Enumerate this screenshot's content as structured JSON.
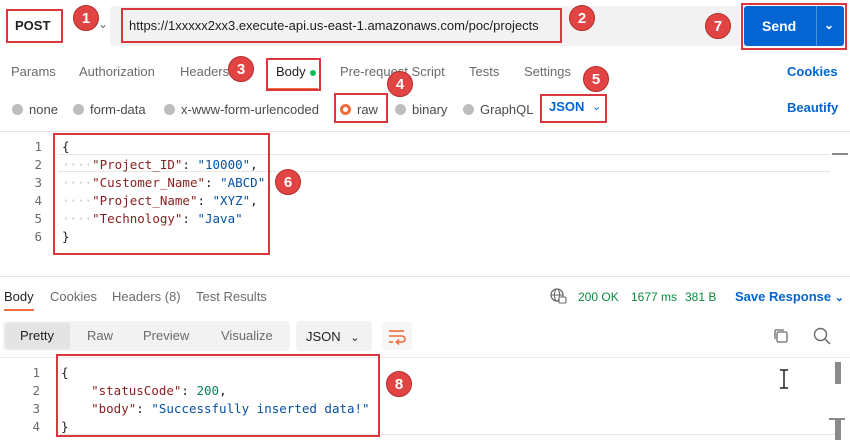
{
  "request": {
    "method": "POST",
    "url": "https://1xxxxx2xx3.execute-api.us-east-1.amazonaws.com/poc/projects",
    "send_label": "Send"
  },
  "tabs": [
    {
      "label": "Params"
    },
    {
      "label": "Authorization"
    },
    {
      "label": "Headers"
    },
    {
      "label": "Body"
    },
    {
      "label": "Pre-request Script"
    },
    {
      "label": "Tests"
    },
    {
      "label": "Settings"
    }
  ],
  "cookies_label": "Cookies",
  "body_types": [
    {
      "label": "none"
    },
    {
      "label": "form-data"
    },
    {
      "label": "x-www-form-urlencoded"
    },
    {
      "label": "raw"
    },
    {
      "label": "binary"
    },
    {
      "label": "GraphQL"
    }
  ],
  "body_format": "JSON",
  "beautify_label": "Beautify",
  "request_body_lines": [
    {
      "no": "1",
      "open": "{"
    },
    {
      "no": "2",
      "key": "\"Project_ID\"",
      "value": "\"10000\"",
      "comma": ","
    },
    {
      "no": "3",
      "key": "\"Customer_Name\"",
      "value": "\"ABCD\"",
      "comma": ","
    },
    {
      "no": "4",
      "key": "\"Project_Name\"",
      "value": "\"XYZ\"",
      "comma": ","
    },
    {
      "no": "5",
      "key": "\"Technology\"",
      "value": "\"Java\"",
      "comma": ""
    },
    {
      "no": "6",
      "close": "}"
    }
  ],
  "response": {
    "tabs": [
      {
        "label": "Body"
      },
      {
        "label": "Cookies"
      },
      {
        "label": "Headers (8)"
      },
      {
        "label": "Test Results"
      }
    ],
    "status": "200 OK",
    "time": "1677 ms",
    "size": "381 B",
    "save_label": "Save Response",
    "views": [
      {
        "label": "Pretty"
      },
      {
        "label": "Raw"
      },
      {
        "label": "Preview"
      },
      {
        "label": "Visualize"
      }
    ],
    "format": "JSON",
    "body_lines": [
      {
        "no": "1",
        "open": "{"
      },
      {
        "no": "2",
        "key": "\"statusCode\"",
        "value": "200",
        "comma": ","
      },
      {
        "no": "3",
        "key": "\"body\"",
        "value": "\"Successfully inserted data!\"",
        "comma": ""
      },
      {
        "no": "4",
        "close": "}"
      }
    ]
  },
  "annotations": [
    "1",
    "2",
    "3",
    "4",
    "5",
    "6",
    "7",
    "8"
  ],
  "colors": {
    "accent_orange": "#f26b3a",
    "primary_blue": "#0265d2",
    "annotation_red": "#d9363e",
    "status_green": "#0a8a3e"
  }
}
